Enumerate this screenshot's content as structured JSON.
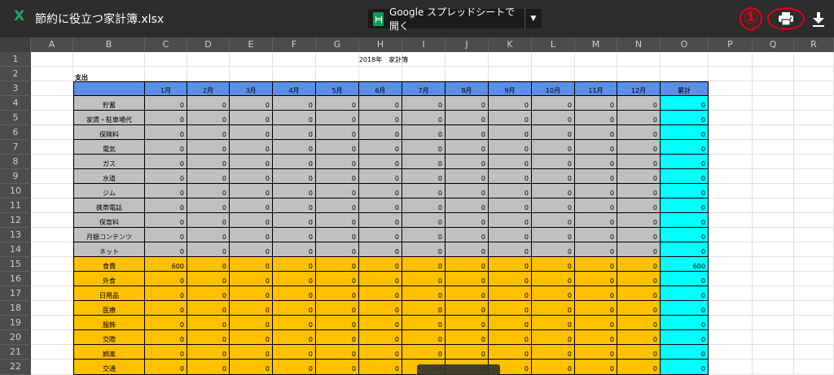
{
  "header": {
    "file_name": "節約に役立つ家計簿.xlsx",
    "open_with_label": "Google スプレッドシートで開く",
    "callout_number": "①",
    "print_icon": "print-icon",
    "download_icon": "download-icon"
  },
  "column_letters": [
    "A",
    "B",
    "C",
    "D",
    "E",
    "F",
    "G",
    "H",
    "I",
    "J",
    "K",
    "L",
    "M",
    "N",
    "O",
    "P",
    "Q",
    "R"
  ],
  "row_numbers": [
    "1",
    "2",
    "3",
    "4",
    "5",
    "6",
    "7",
    "8",
    "9",
    "10",
    "11",
    "12",
    "13",
    "14",
    "15",
    "16",
    "17",
    "18",
    "19",
    "20",
    "21",
    "22"
  ],
  "sheet": {
    "title": "2018年　家計簿",
    "section_label": "支出",
    "months": [
      "1月",
      "2月",
      "3月",
      "4月",
      "5月",
      "6月",
      "7月",
      "8月",
      "9月",
      "10月",
      "11月",
      "12月"
    ],
    "total_label": "累計",
    "rows": [
      {
        "label": "貯蓄",
        "group": "gray",
        "values": [
          "0",
          "0",
          "0",
          "0",
          "0",
          "0",
          "0",
          "0",
          "0",
          "0",
          "0",
          "0"
        ],
        "total": "0"
      },
      {
        "label": "家賃・駐車場代",
        "group": "gray",
        "values": [
          "0",
          "0",
          "0",
          "0",
          "0",
          "0",
          "0",
          "0",
          "0",
          "0",
          "0",
          "0"
        ],
        "total": "0"
      },
      {
        "label": "保険料",
        "group": "gray",
        "values": [
          "0",
          "0",
          "0",
          "0",
          "0",
          "0",
          "0",
          "0",
          "0",
          "0",
          "0",
          "0"
        ],
        "total": "0"
      },
      {
        "label": "電気",
        "group": "gray",
        "values": [
          "0",
          "0",
          "0",
          "0",
          "0",
          "0",
          "0",
          "0",
          "0",
          "0",
          "0",
          "0"
        ],
        "total": "0"
      },
      {
        "label": "ガス",
        "group": "gray",
        "values": [
          "0",
          "0",
          "0",
          "0",
          "0",
          "0",
          "0",
          "0",
          "0",
          "0",
          "0",
          "0"
        ],
        "total": "0"
      },
      {
        "label": "水道",
        "group": "gray",
        "values": [
          "0",
          "0",
          "0",
          "0",
          "0",
          "0",
          "0",
          "0",
          "0",
          "0",
          "0",
          "0"
        ],
        "total": "0"
      },
      {
        "label": "ジム",
        "group": "gray",
        "values": [
          "0",
          "0",
          "0",
          "0",
          "0",
          "0",
          "0",
          "0",
          "0",
          "0",
          "0",
          "0"
        ],
        "total": "0"
      },
      {
        "label": "携帯電話",
        "group": "gray",
        "values": [
          "0",
          "0",
          "0",
          "0",
          "0",
          "0",
          "0",
          "0",
          "0",
          "0",
          "0",
          "0"
        ],
        "total": "0"
      },
      {
        "label": "保育料",
        "group": "gray",
        "values": [
          "0",
          "0",
          "0",
          "0",
          "0",
          "0",
          "0",
          "0",
          "0",
          "0",
          "0",
          "0"
        ],
        "total": "0"
      },
      {
        "label": "月額コンテンツ",
        "group": "gray",
        "values": [
          "0",
          "0",
          "0",
          "0",
          "0",
          "0",
          "0",
          "0",
          "0",
          "0",
          "0",
          "0"
        ],
        "total": "0"
      },
      {
        "label": "ネット",
        "group": "gray",
        "values": [
          "0",
          "0",
          "0",
          "0",
          "0",
          "0",
          "0",
          "0",
          "0",
          "0",
          "0",
          "0"
        ],
        "total": "0"
      },
      {
        "label": "食費",
        "group": "orange",
        "values": [
          "600",
          "0",
          "0",
          "0",
          "0",
          "0",
          "0",
          "0",
          "0",
          "0",
          "0",
          "0"
        ],
        "total": "600"
      },
      {
        "label": "外食",
        "group": "orange",
        "values": [
          "0",
          "0",
          "0",
          "0",
          "0",
          "0",
          "0",
          "0",
          "0",
          "0",
          "0",
          "0"
        ],
        "total": "0"
      },
      {
        "label": "日用品",
        "group": "orange",
        "values": [
          "0",
          "0",
          "0",
          "0",
          "0",
          "0",
          "0",
          "0",
          "0",
          "0",
          "0",
          "0"
        ],
        "total": "0"
      },
      {
        "label": "医療",
        "group": "orange",
        "values": [
          "0",
          "0",
          "0",
          "0",
          "0",
          "0",
          "0",
          "0",
          "0",
          "0",
          "0",
          "0"
        ],
        "total": "0"
      },
      {
        "label": "服飾",
        "group": "orange",
        "values": [
          "0",
          "0",
          "0",
          "0",
          "0",
          "0",
          "0",
          "0",
          "0",
          "0",
          "0",
          "0"
        ],
        "total": "0"
      },
      {
        "label": "交際",
        "group": "orange",
        "values": [
          "0",
          "0",
          "0",
          "0",
          "0",
          "0",
          "0",
          "0",
          "0",
          "0",
          "0",
          "0"
        ],
        "total": "0"
      },
      {
        "label": "娯楽",
        "group": "orange",
        "values": [
          "0",
          "0",
          "0",
          "0",
          "0",
          "0",
          "0",
          "0",
          "0",
          "0",
          "0",
          "0"
        ],
        "total": "0"
      },
      {
        "label": "交通",
        "group": "orange",
        "values": [
          "0",
          "0",
          "0",
          "0",
          "0",
          "0",
          "0",
          "0",
          "0",
          "0",
          "0",
          "0"
        ],
        "total": "0"
      }
    ]
  },
  "colors": {
    "header_blue": "#5b8ee6",
    "gray_fill": "#c0c0c0",
    "orange_fill": "#ffc000",
    "total_fill": "#00ffff",
    "callout_red": "#e60012"
  }
}
